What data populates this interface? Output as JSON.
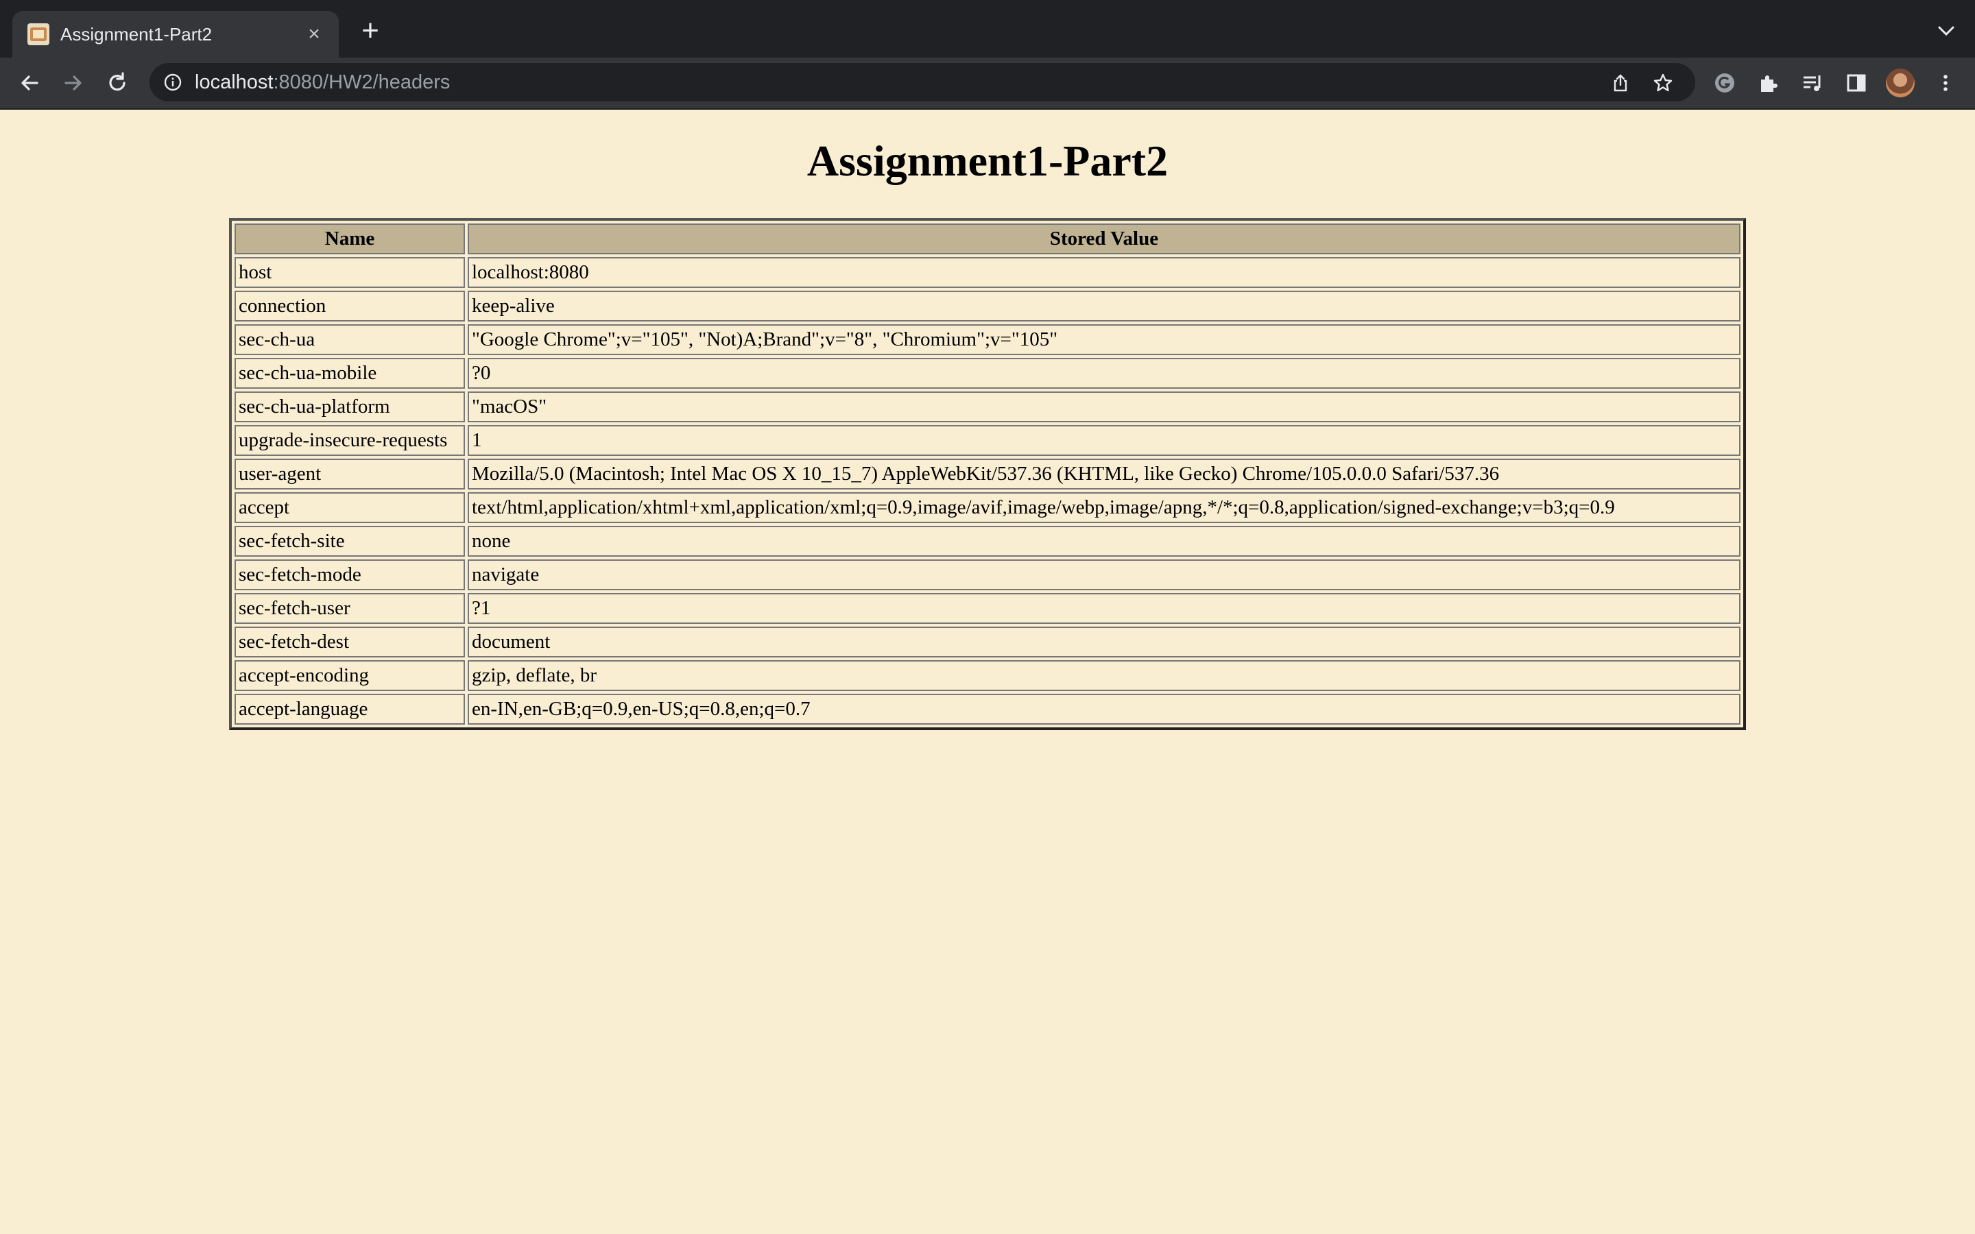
{
  "browser": {
    "tab": {
      "title": "Assignment1-Part2",
      "close_glyph": "×"
    },
    "new_tab_glyph": "+",
    "address": {
      "host": "localhost",
      "rest": ":8080/HW2/headers"
    }
  },
  "page": {
    "title": "Assignment1-Part2",
    "background": "#faeed2",
    "header_background": "#bfb393"
  },
  "table": {
    "columns": [
      "Name",
      "Stored Value"
    ],
    "rows": [
      {
        "name": "host",
        "value": "localhost:8080"
      },
      {
        "name": "connection",
        "value": "keep-alive"
      },
      {
        "name": "sec-ch-ua",
        "value": "\"Google Chrome\";v=\"105\", \"Not)A;Brand\";v=\"8\", \"Chromium\";v=\"105\""
      },
      {
        "name": "sec-ch-ua-mobile",
        "value": "?0"
      },
      {
        "name": "sec-ch-ua-platform",
        "value": "\"macOS\""
      },
      {
        "name": "upgrade-insecure-requests",
        "value": "1"
      },
      {
        "name": "user-agent",
        "value": "Mozilla/5.0 (Macintosh; Intel Mac OS X 10_15_7) AppleWebKit/537.36 (KHTML, like Gecko) Chrome/105.0.0.0 Safari/537.36"
      },
      {
        "name": "accept",
        "value": "text/html,application/xhtml+xml,application/xml;q=0.9,image/avif,image/webp,image/apng,*/*;q=0.8,application/signed-exchange;v=b3;q=0.9"
      },
      {
        "name": "sec-fetch-site",
        "value": "none"
      },
      {
        "name": "sec-fetch-mode",
        "value": "navigate"
      },
      {
        "name": "sec-fetch-user",
        "value": "?1"
      },
      {
        "name": "sec-fetch-dest",
        "value": "document"
      },
      {
        "name": "accept-encoding",
        "value": "gzip, deflate, br"
      },
      {
        "name": "accept-language",
        "value": "en-IN,en-GB;q=0.9,en-US;q=0.8,en;q=0.7"
      }
    ]
  }
}
